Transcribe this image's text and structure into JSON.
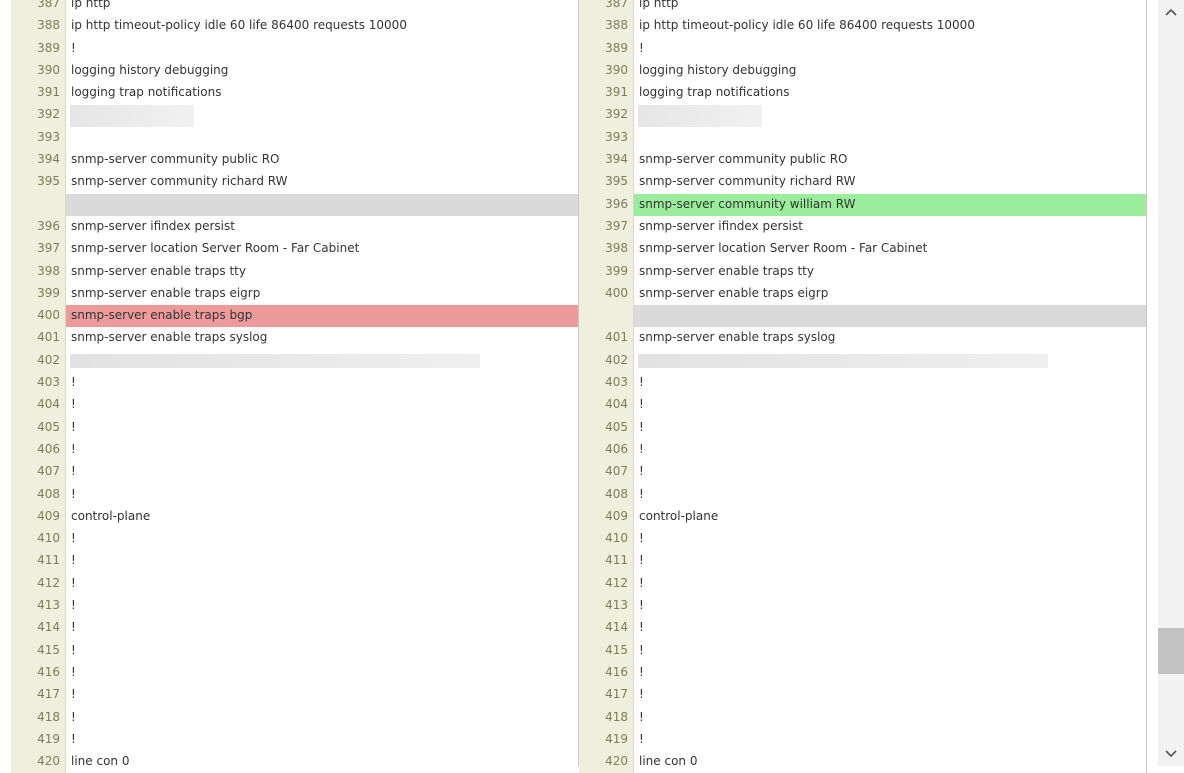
{
  "left": [
    {
      "n": "387",
      "t": "ip http",
      "type": "same"
    },
    {
      "n": "388",
      "t": "ip http timeout-policy idle 60 life 86400 requests 10000",
      "type": "same"
    },
    {
      "n": "389",
      "t": "!",
      "type": "same"
    },
    {
      "n": "390",
      "t": "logging history debugging",
      "type": "same"
    },
    {
      "n": "391",
      "t": "logging trap notifications",
      "type": "same"
    },
    {
      "n": "392",
      "t": "",
      "type": "redacted-top"
    },
    {
      "n": "393",
      "t": "",
      "type": "redacted-bottom"
    },
    {
      "n": "394",
      "t": "snmp-server community public RO",
      "type": "same"
    },
    {
      "n": "395",
      "t": "snmp-server community richard RW",
      "type": "same"
    },
    {
      "n": "",
      "t": "",
      "type": "gap"
    },
    {
      "n": "396",
      "t": "snmp-server ifindex persist",
      "type": "same"
    },
    {
      "n": "397",
      "t": "snmp-server location Server Room - Far Cabinet",
      "type": "same"
    },
    {
      "n": "398",
      "t": "snmp-server enable traps tty",
      "type": "same"
    },
    {
      "n": "399",
      "t": "snmp-server enable traps eigrp",
      "type": "same"
    },
    {
      "n": "400",
      "t": "snmp-server enable traps bgp",
      "type": "removed"
    },
    {
      "n": "401",
      "t": "snmp-server enable traps syslog",
      "type": "same"
    },
    {
      "n": "402",
      "t": "",
      "type": "redacted-line"
    },
    {
      "n": "403",
      "t": "!",
      "type": "same"
    },
    {
      "n": "404",
      "t": "!",
      "type": "same"
    },
    {
      "n": "405",
      "t": "!",
      "type": "same"
    },
    {
      "n": "406",
      "t": "!",
      "type": "same"
    },
    {
      "n": "407",
      "t": "!",
      "type": "same"
    },
    {
      "n": "408",
      "t": "!",
      "type": "same"
    },
    {
      "n": "409",
      "t": "control-plane",
      "type": "same"
    },
    {
      "n": "410",
      "t": "!",
      "type": "same"
    },
    {
      "n": "411",
      "t": "!",
      "type": "same"
    },
    {
      "n": "412",
      "t": "!",
      "type": "same"
    },
    {
      "n": "413",
      "t": "!",
      "type": "same"
    },
    {
      "n": "414",
      "t": "!",
      "type": "same"
    },
    {
      "n": "415",
      "t": "!",
      "type": "same"
    },
    {
      "n": "416",
      "t": "!",
      "type": "same"
    },
    {
      "n": "417",
      "t": "!",
      "type": "same"
    },
    {
      "n": "418",
      "t": "!",
      "type": "same"
    },
    {
      "n": "419",
      "t": "!",
      "type": "same"
    },
    {
      "n": "420",
      "t": "line con 0",
      "type": "same"
    }
  ],
  "right": [
    {
      "n": "387",
      "t": "ip http",
      "type": "same"
    },
    {
      "n": "388",
      "t": "ip http timeout-policy idle 60 life 86400 requests 10000",
      "type": "same"
    },
    {
      "n": "389",
      "t": "!",
      "type": "same"
    },
    {
      "n": "390",
      "t": "logging history debugging",
      "type": "same"
    },
    {
      "n": "391",
      "t": "logging trap notifications",
      "type": "same"
    },
    {
      "n": "392",
      "t": "",
      "type": "redacted-top"
    },
    {
      "n": "393",
      "t": "",
      "type": "redacted-bottom"
    },
    {
      "n": "394",
      "t": "snmp-server community public RO",
      "type": "same"
    },
    {
      "n": "395",
      "t": "snmp-server community richard RW",
      "type": "same"
    },
    {
      "n": "396",
      "t": "snmp-server community william RW",
      "type": "added"
    },
    {
      "n": "397",
      "t": "snmp-server ifindex persist",
      "type": "same"
    },
    {
      "n": "398",
      "t": "snmp-server location Server Room - Far Cabinet",
      "type": "same"
    },
    {
      "n": "399",
      "t": "snmp-server enable traps tty",
      "type": "same"
    },
    {
      "n": "400",
      "t": "snmp-server enable traps eigrp",
      "type": "same"
    },
    {
      "n": "",
      "t": "",
      "type": "gap"
    },
    {
      "n": "401",
      "t": "snmp-server enable traps syslog",
      "type": "same"
    },
    {
      "n": "402",
      "t": "",
      "type": "redacted-line"
    },
    {
      "n": "403",
      "t": "!",
      "type": "same"
    },
    {
      "n": "404",
      "t": "!",
      "type": "same"
    },
    {
      "n": "405",
      "t": "!",
      "type": "same"
    },
    {
      "n": "406",
      "t": "!",
      "type": "same"
    },
    {
      "n": "407",
      "t": "!",
      "type": "same"
    },
    {
      "n": "408",
      "t": "!",
      "type": "same"
    },
    {
      "n": "409",
      "t": "control-plane",
      "type": "same"
    },
    {
      "n": "410",
      "t": "!",
      "type": "same"
    },
    {
      "n": "411",
      "t": "!",
      "type": "same"
    },
    {
      "n": "412",
      "t": "!",
      "type": "same"
    },
    {
      "n": "413",
      "t": "!",
      "type": "same"
    },
    {
      "n": "414",
      "t": "!",
      "type": "same"
    },
    {
      "n": "415",
      "t": "!",
      "type": "same"
    },
    {
      "n": "416",
      "t": "!",
      "type": "same"
    },
    {
      "n": "417",
      "t": "!",
      "type": "same"
    },
    {
      "n": "418",
      "t": "!",
      "type": "same"
    },
    {
      "n": "419",
      "t": "!",
      "type": "same"
    },
    {
      "n": "420",
      "t": "line con 0",
      "type": "same"
    }
  ],
  "colors": {
    "removed": "#ed9a9a",
    "added": "#9aed9a",
    "gap": "#dadada",
    "gutter": "#efefdd"
  },
  "scrollbar": {
    "up_icon": "chevron-up-icon",
    "down_icon": "chevron-down-icon",
    "position_fraction": 0.85
  }
}
